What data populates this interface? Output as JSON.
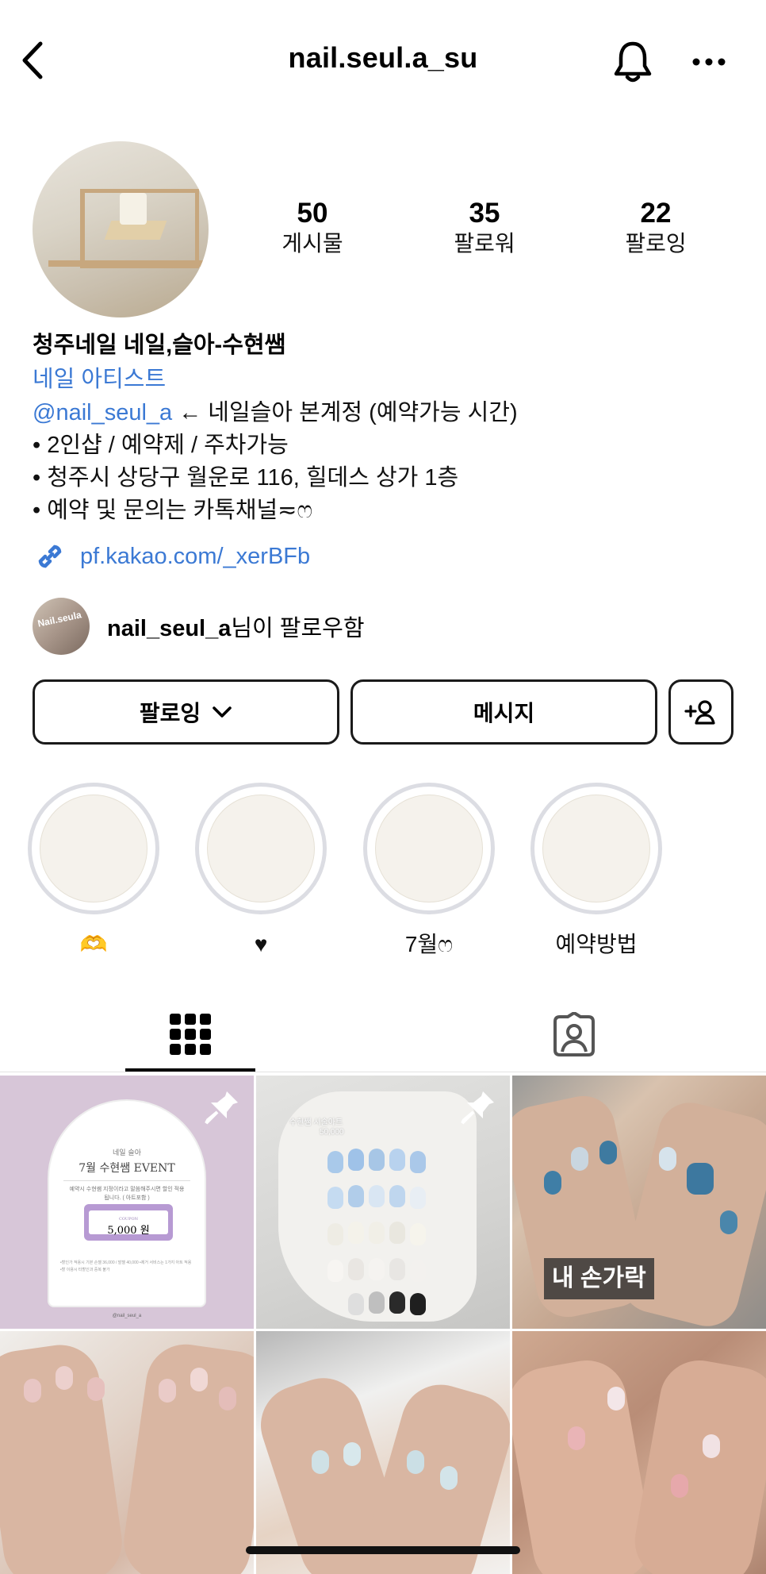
{
  "header": {
    "username": "nail.seul.a_su"
  },
  "profile": {
    "stats": [
      {
        "value": "50",
        "label": "게시물"
      },
      {
        "value": "35",
        "label": "팔로워"
      },
      {
        "value": "22",
        "label": "팔로잉"
      }
    ],
    "name": "청주네일 네일,슬아-수현쌤",
    "category": "네일 아티스트",
    "bio": {
      "mention": "@nail_seul_a",
      "mention_suffix": " ← 네일슬아 본계정 (예약가능 시간)",
      "lines": [
        "• 2인샵 / 예약제 / 주차가능",
        "• 청주시 상당구 월운로 116, 힐데스 상가 1층",
        "• 예약 및 문의는 카톡채널≂ෆ"
      ]
    },
    "link": "pf.kakao.com/_xerBFb",
    "followed_by": {
      "user": "nail_seul_a",
      "suffix": "님이 팔로우함",
      "avatar_text": "Nail.seula"
    }
  },
  "buttons": {
    "following": "팔로잉",
    "message": "메시지"
  },
  "highlights": [
    {
      "label": "🫶"
    },
    {
      "label": "♥"
    },
    {
      "label": "7월ෆ"
    },
    {
      "label": "예약방법"
    }
  ],
  "posts": {
    "post1": {
      "small_title": "네일 슬아",
      "title": "7월 수현쌤 EVENT",
      "desc": "예약시 수현쌤 지정이라고 말씀해주시면 할인 적용됩니다. ( 아트포함 )",
      "coupon_label": "COUPON",
      "coupon_amount": "5,000 원",
      "notes": "•할인가 적용시 기본 손젤 36,000 / 발젤 40,000 •제거 서비스는 1가지 아트 적용 •할 이용시 타할인과 중복 불가",
      "handle": "@nail_seul_a"
    },
    "post2": {
      "title": "수현쌤 시술아트",
      "price": "50,000"
    },
    "post3": {
      "tag": "내 손가락"
    }
  },
  "colors": {
    "link": "#3b79d4",
    "highlight_ring": "#dcdde3"
  },
  "icons": [
    "back-arrow-icon",
    "bell-icon",
    "more-icon",
    "link-icon",
    "chevron-down-icon",
    "add-person-icon",
    "grid-icon",
    "tagged-icon",
    "pin-icon"
  ]
}
